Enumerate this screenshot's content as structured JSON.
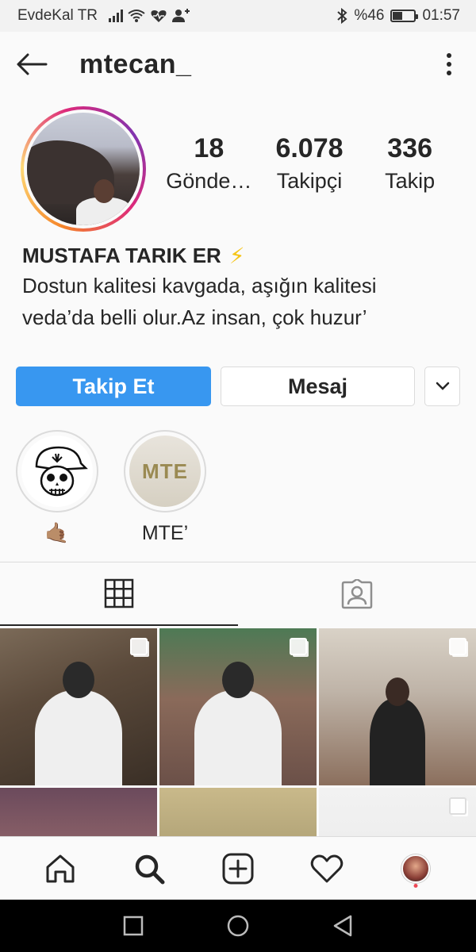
{
  "status_bar": {
    "carrier": "EvdeKal TR",
    "battery_percent": "%46",
    "battery_level": 0.46,
    "time": "01:57"
  },
  "header": {
    "username": "mtecan_",
    "back_icon": "back-arrow-icon",
    "more_icon": "more-vertical-icon"
  },
  "profile": {
    "stats": [
      {
        "count": "18",
        "label": "Gönde…"
      },
      {
        "count": "6.078",
        "label": "Takipçi"
      },
      {
        "count": "336",
        "label": "Takip"
      }
    ],
    "full_name": "MUSTAFA TARIK ER",
    "name_emoji": "⚡",
    "bio_line1": "Dostun kalitesi kavgada, aşığın kalitesi",
    "bio_line2": "veda’da belli olur.Az insan, çok huzur’"
  },
  "actions": {
    "follow_label": "Takip Et",
    "message_label": "Mesaj",
    "follow_color": "#3897f0"
  },
  "highlights": [
    {
      "label": "🤙🏽",
      "cover": "skull-cap-drawing"
    },
    {
      "label": "MTE’",
      "cover": "MTE"
    }
  ],
  "tabs": [
    {
      "name": "grid",
      "icon": "grid-icon",
      "active": true
    },
    {
      "name": "tagged",
      "icon": "tagged-person-icon",
      "active": false
    }
  ],
  "bottom_nav": [
    "home-icon",
    "search-icon",
    "add-post-icon",
    "heart-icon",
    "profile-avatar"
  ],
  "colors": {
    "accent": "#3897f0",
    "notification_dot": "#ed4956"
  }
}
